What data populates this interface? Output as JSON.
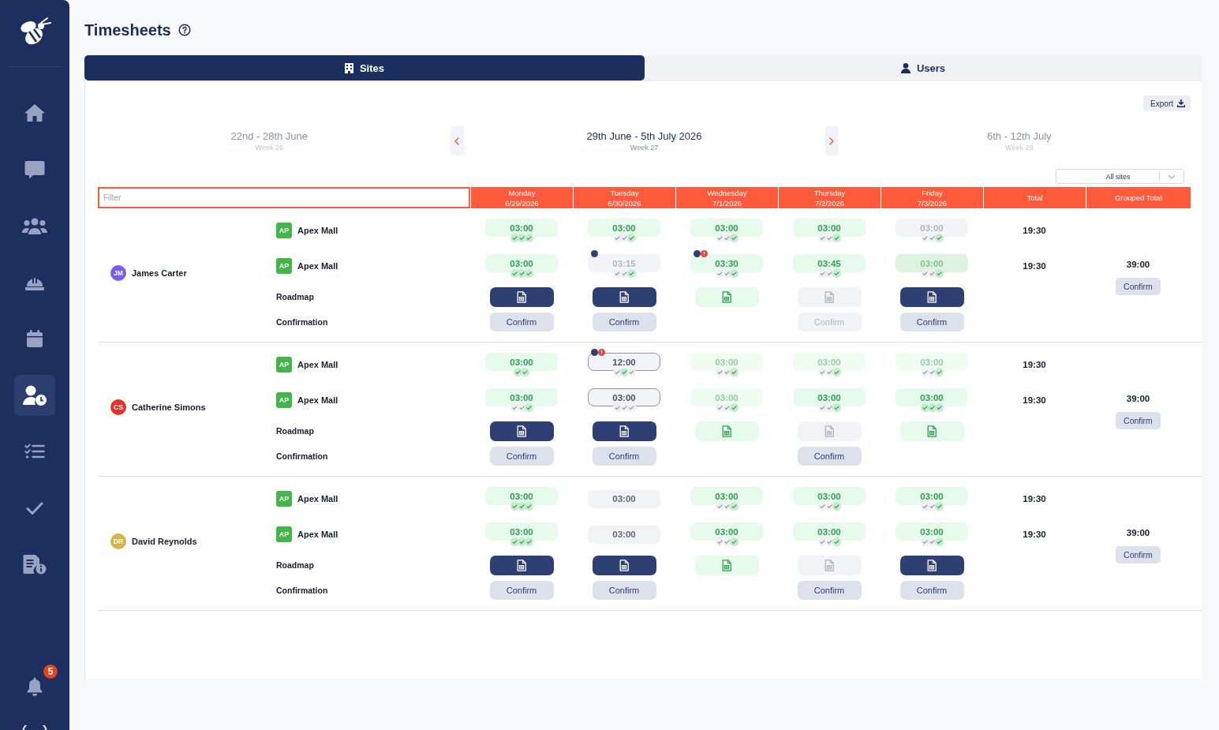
{
  "sidebar": {
    "items": [
      {
        "selected": false
      },
      {
        "selected": false
      },
      {
        "selected": false
      },
      {
        "selected": false
      },
      {
        "selected": false
      },
      {
        "selected": true
      },
      {
        "selected": false
      },
      {
        "selected": false
      },
      {
        "selected": false
      }
    ],
    "notifications": {
      "badge": "5"
    }
  },
  "header": {
    "title": "Timesheets"
  },
  "tabs": [
    {
      "label": "Sites",
      "selected": true
    },
    {
      "label": "Users",
      "selected": false
    }
  ],
  "toolbar": {
    "export": "Export"
  },
  "weeks": {
    "previous": {
      "range": "22nd - 28th June",
      "week": "Week 26"
    },
    "current": {
      "range": "29th June - 5th July 2026",
      "week": "Week 27"
    },
    "next": {
      "range": "6th - 12th July",
      "week": "Week 28"
    }
  },
  "site_filter": {
    "value": "All sites"
  },
  "table": {
    "filter": {
      "placeholder": "Filter"
    },
    "days": [
      {
        "day": "Monday",
        "date": "6/29/2026"
      },
      {
        "day": "Tuesday",
        "date": "6/30/2026"
      },
      {
        "day": "Wednesday",
        "date": "7/1/2026"
      },
      {
        "day": "Thursday",
        "date": "7/2/2026"
      },
      {
        "day": "Friday",
        "date": "7/3/2026"
      }
    ],
    "total_header": "Total",
    "grouped_total_header": "Grouped Total",
    "employees": [
      {
        "name": "James Carter",
        "initials": "JM",
        "color": "#7b5cf0",
        "roadmap_label": "Roadmap",
        "confirmation_label": "Confirmation",
        "grouped_total": {
          "value": "39:00",
          "confirm": "Confirm"
        },
        "sites": [
          {
            "badge": "AP",
            "name": "Apex Mall",
            "total": "19:30",
            "shifts": [
              {
                "time": "03:00",
                "kind": "approved",
                "ticks": [
                  {
                    "checked": true
                  },
                  {
                    "checked": true
                  },
                  {
                    "checked": true
                  }
                ]
              },
              {
                "time": "03:00",
                "kind": "approved",
                "ticks": [
                  {
                    "checked": false
                  },
                  {
                    "checked": false
                  },
                  {
                    "checked": true
                  }
                ]
              },
              {
                "time": "03:00",
                "kind": "approved",
                "ticks": [
                  {
                    "checked": false
                  },
                  {
                    "checked": false
                  },
                  {
                    "checked": true
                  }
                ]
              },
              {
                "time": "03:00",
                "kind": "approved",
                "ticks": [
                  {
                    "checked": false
                  },
                  {
                    "checked": false
                  },
                  {
                    "checked": true
                  }
                ]
              },
              {
                "time": "03:00",
                "kind": "muted",
                "ticks": [
                  {
                    "checked": false
                  },
                  {
                    "checked": false
                  },
                  {
                    "checked": true
                  }
                ]
              }
            ]
          },
          {
            "badge": "AP",
            "name": "Apex Mall",
            "total": "19:30",
            "shifts": [
              {
                "time": "03:00",
                "kind": "approved",
                "ticks": [
                  {
                    "checked": true
                  },
                  {
                    "checked": true
                  },
                  {
                    "checked": true
                  }
                ]
              },
              {
                "time": "03:15",
                "kind": "muted",
                "markers": [
                  {
                    "kind": "note"
                  }
                ],
                "ticks": [
                  {
                    "checked": false
                  },
                  {
                    "checked": false
                  },
                  {
                    "checked": true
                  }
                ]
              },
              {
                "time": "03:30",
                "kind": "approved",
                "markers": [
                  {
                    "kind": "note"
                  },
                  {
                    "kind": "alert"
                  }
                ],
                "ticks": [
                  {
                    "checked": false
                  },
                  {
                    "checked": false
                  },
                  {
                    "checked": true
                  }
                ]
              },
              {
                "time": "03:45",
                "kind": "approved",
                "ticks": [
                  {
                    "checked": false
                  },
                  {
                    "checked": false
                  },
                  {
                    "checked": true
                  }
                ]
              },
              {
                "time": "03:00",
                "kind": "locked",
                "ticks": [
                  {
                    "checked": false
                  },
                  {
                    "checked": false
                  },
                  {
                    "checked": true
                  }
                ]
              }
            ]
          }
        ],
        "days": [
          {
            "roadmap": {
              "kind": "primary"
            },
            "confirm": {
              "label": "Confirm",
              "disabled": false
            }
          },
          {
            "roadmap": {
              "kind": "primary"
            },
            "confirm": {
              "label": "Confirm",
              "disabled": false
            }
          },
          {
            "roadmap": {
              "kind": "done"
            }
          },
          {
            "roadmap": {
              "kind": "disabled"
            },
            "confirm": {
              "label": "Confirm",
              "disabled": true
            }
          },
          {
            "roadmap": {
              "kind": "primary"
            },
            "confirm": {
              "label": "Confirm",
              "disabled": false
            }
          }
        ]
      },
      {
        "name": "Catherine Simons",
        "initials": "CS",
        "color": "#e8302a",
        "roadmap_label": "Roadmap",
        "confirmation_label": "Confirmation",
        "grouped_total": {
          "value": "39:00",
          "confirm": "Confirm"
        },
        "sites": [
          {
            "badge": "AP",
            "name": "Apex Mall",
            "total": "19:30",
            "shifts": [
              {
                "time": "03:00",
                "kind": "approved",
                "ticks": [
                  {
                    "checked": true
                  },
                  {
                    "checked": true
                  }
                ]
              },
              {
                "time": "12:00",
                "kind": "edited",
                "markers": [
                  {
                    "kind": "note"
                  },
                  {
                    "kind": "alert"
                  }
                ],
                "ticks": [
                  {
                    "checked": false
                  },
                  {
                    "checked": true
                  },
                  {
                    "checked": false
                  }
                ]
              },
              {
                "time": "03:00",
                "kind": "faded",
                "ticks": [
                  {
                    "checked": false
                  },
                  {
                    "checked": false
                  },
                  {
                    "checked": true
                  }
                ]
              },
              {
                "time": "03:00",
                "kind": "faded",
                "ticks": [
                  {
                    "checked": false
                  },
                  {
                    "checked": false
                  },
                  {
                    "checked": true
                  }
                ]
              },
              {
                "time": "03:00",
                "kind": "faded",
                "ticks": [
                  {
                    "checked": false
                  },
                  {
                    "checked": false
                  },
                  {
                    "checked": true
                  }
                ]
              }
            ]
          },
          {
            "badge": "AP",
            "name": "Apex Mall",
            "total": "19:30",
            "shifts": [
              {
                "time": "03:00",
                "kind": "approved",
                "ticks": [
                  {
                    "checked": false
                  },
                  {
                    "checked": false
                  },
                  {
                    "checked": true
                  }
                ]
              },
              {
                "time": "03:00",
                "kind": "edited",
                "ticks": [
                  {
                    "checked": false
                  },
                  {
                    "checked": false
                  },
                  {
                    "checked": false
                  }
                ]
              },
              {
                "time": "03:00",
                "kind": "faded",
                "ticks": [
                  {
                    "checked": false
                  },
                  {
                    "checked": false
                  },
                  {
                    "checked": true
                  }
                ]
              },
              {
                "time": "03:00",
                "kind": "approved",
                "ticks": [
                  {
                    "checked": false
                  },
                  {
                    "checked": false
                  },
                  {
                    "checked": true
                  }
                ]
              },
              {
                "time": "03:00",
                "kind": "approved",
                "ticks": [
                  {
                    "checked": true
                  },
                  {
                    "checked": true
                  },
                  {
                    "checked": true
                  }
                ]
              }
            ]
          }
        ],
        "days": [
          {
            "roadmap": {
              "kind": "primary"
            },
            "confirm": {
              "label": "Confirm",
              "disabled": false
            }
          },
          {
            "roadmap": {
              "kind": "primary"
            },
            "confirm": {
              "label": "Confirm",
              "disabled": false
            }
          },
          {
            "roadmap": {
              "kind": "done"
            }
          },
          {
            "roadmap": {
              "kind": "disabled"
            },
            "confirm": {
              "label": "Confirm",
              "disabled": false
            }
          },
          {
            "roadmap": {
              "kind": "done"
            }
          }
        ]
      },
      {
        "name": "David Reynolds",
        "initials": "DR",
        "color": "#d6b449",
        "roadmap_label": "Roadmap",
        "confirmation_label": "Confirmation",
        "grouped_total": {
          "value": "39:00",
          "confirm": "Confirm"
        },
        "sites": [
          {
            "badge": "AP",
            "name": "Apex Mall",
            "total": "19:30",
            "shifts": [
              {
                "time": "03:00",
                "kind": "approved",
                "ticks": [
                  {
                    "checked": true
                  },
                  {
                    "checked": true
                  },
                  {
                    "checked": true
                  }
                ]
              },
              {
                "time": "03:00",
                "kind": "pending"
              },
              {
                "time": "03:00",
                "kind": "approved",
                "ticks": [
                  {
                    "checked": false
                  },
                  {
                    "checked": false
                  },
                  {
                    "checked": true
                  }
                ]
              },
              {
                "time": "03:00",
                "kind": "approved",
                "ticks": [
                  {
                    "checked": false
                  },
                  {
                    "checked": false
                  },
                  {
                    "checked": true
                  }
                ]
              },
              {
                "time": "03:00",
                "kind": "approved",
                "ticks": [
                  {
                    "checked": false
                  },
                  {
                    "checked": false
                  },
                  {
                    "checked": true
                  }
                ]
              }
            ]
          },
          {
            "badge": "AP",
            "name": "Apex Mall",
            "total": "19:30",
            "shifts": [
              {
                "time": "03:00",
                "kind": "approved",
                "ticks": [
                  {
                    "checked": true
                  },
                  {
                    "checked": true
                  },
                  {
                    "checked": true
                  }
                ]
              },
              {
                "time": "03:00",
                "kind": "pending"
              },
              {
                "time": "03:00",
                "kind": "approved",
                "ticks": [
                  {
                    "checked": false
                  },
                  {
                    "checked": false
                  },
                  {
                    "checked": true
                  }
                ]
              },
              {
                "time": "03:00",
                "kind": "approved",
                "ticks": [
                  {
                    "checked": false
                  },
                  {
                    "checked": false
                  },
                  {
                    "checked": true
                  }
                ]
              },
              {
                "time": "03:00",
                "kind": "approved",
                "ticks": [
                  {
                    "checked": false
                  },
                  {
                    "checked": false
                  },
                  {
                    "checked": true
                  }
                ]
              }
            ]
          }
        ],
        "days": [
          {
            "roadmap": {
              "kind": "primary"
            },
            "confirm": {
              "label": "Confirm",
              "disabled": false
            }
          },
          {
            "roadmap": {
              "kind": "primary"
            },
            "confirm": {
              "label": "Confirm",
              "disabled": false
            }
          },
          {
            "roadmap": {
              "kind": "done"
            }
          },
          {
            "roadmap": {
              "kind": "disabled"
            },
            "confirm": {
              "label": "Confirm",
              "disabled": false
            }
          },
          {
            "roadmap": {
              "kind": "primary"
            },
            "confirm": {
              "label": "Confirm",
              "disabled": false
            }
          }
        ]
      }
    ]
  }
}
